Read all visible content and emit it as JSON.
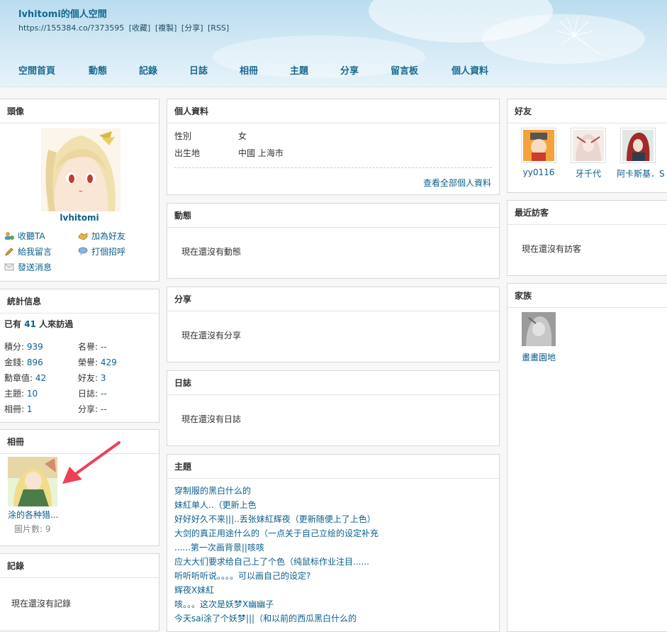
{
  "header": {
    "title": "lvhitomi的個人空間",
    "url": "https://155384.co/?373595",
    "links": [
      "[收藏]",
      "[複製]",
      "[分享]",
      "[RSS]"
    ],
    "nav": [
      "空間首頁",
      "動態",
      "記錄",
      "日誌",
      "相冊",
      "主題",
      "分享",
      "留言板",
      "個人資料"
    ]
  },
  "avatar_panel": {
    "title": "頭像",
    "name": "lvhitomi",
    "actions": {
      "follow": "收聽TA",
      "add_friend": "加為好友",
      "message": "給我留言",
      "poke": "打個招呼",
      "send_msg": "發送消息"
    }
  },
  "stats_panel": {
    "title": "統計信息",
    "visitors_prefix": "已有",
    "visitors_count": "41",
    "visitors_suffix": "人來訪過",
    "items": [
      {
        "label": "積分:",
        "value": "939"
      },
      {
        "label": "名譽:",
        "value": "--"
      },
      {
        "label": "金錢:",
        "value": "896"
      },
      {
        "label": "榮譽:",
        "value": "429"
      },
      {
        "label": "勳章值:",
        "value": "42"
      },
      {
        "label": "好友:",
        "value": "3"
      },
      {
        "label": "主題:",
        "value": "10"
      },
      {
        "label": "日誌:",
        "value": "--"
      },
      {
        "label": "相冊:",
        "value": "1"
      },
      {
        "label": "分享:",
        "value": "--"
      }
    ]
  },
  "album_panel": {
    "title": "相冊",
    "album_name": "涂的各种猎...",
    "count_label": "圖片數: 9"
  },
  "records_panel": {
    "title": "記錄",
    "empty": "現在還沒有記錄"
  },
  "profile_panel": {
    "title": "個人資料",
    "rows": [
      {
        "label": "性別",
        "value": "女"
      },
      {
        "label": "出生地",
        "value": "中國 上海市"
      }
    ],
    "view_all": "查看全部個人資料"
  },
  "feed_panel": {
    "title": "動態",
    "empty": "現在還沒有動態"
  },
  "share_panel": {
    "title": "分享",
    "empty": "現在還沒有分享"
  },
  "blog_panel": {
    "title": "日誌",
    "empty": "現在還沒有日誌"
  },
  "topics_panel": {
    "title": "主題",
    "items": [
      "穿制服的黑白什么的",
      "妹紅单人..（更新上色",
      "好好好久不来|||..丢张妹紅辉夜（更新随便上了上色）",
      "大剑的真正用途什么的（一点关于自己立绘的设定补充",
      "......第一次画背景||咳咳",
      "应大大们要求给自己上了个色（纯鼠标作业注目......",
      "听听听听说。。。。可以画自己的设定?",
      "辉夜X妹紅",
      "咳。。。这次是妖梦X幽幽子",
      "今天sai涂了个妖梦|||（和以前的西瓜黑白什么的"
    ]
  },
  "friends_panel": {
    "title": "好友",
    "friends": [
      "yy0116",
      "牙千代",
      "阿卡斯基．S"
    ]
  },
  "visitors_panel": {
    "title": "最近訪客",
    "empty": "現在還沒有訪客"
  },
  "family_panel": {
    "title": "家族",
    "name": "畫畫園地"
  }
}
